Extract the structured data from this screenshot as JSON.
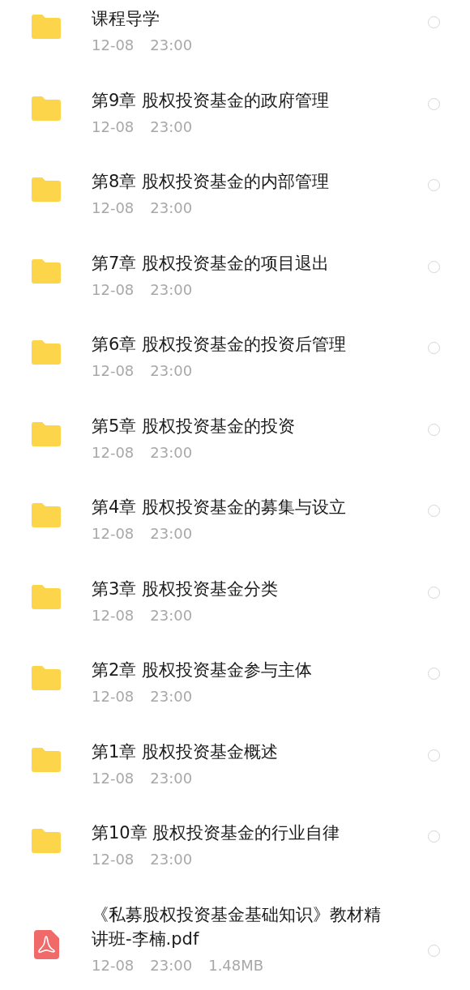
{
  "files": [
    {
      "kind": "folder",
      "name": "课程导学",
      "date": "12-08",
      "time": "23:00",
      "selected": false
    },
    {
      "kind": "folder",
      "name": "第9章 股权投资基金的政府管理",
      "date": "12-08",
      "time": "23:00",
      "selected": false
    },
    {
      "kind": "folder",
      "name": "第8章 股权投资基金的内部管理",
      "date": "12-08",
      "time": "23:00",
      "selected": false
    },
    {
      "kind": "folder",
      "name": "第7章 股权投资基金的项目退出",
      "date": "12-08",
      "time": "23:00",
      "selected": false
    },
    {
      "kind": "folder",
      "name": "第6章 股权投资基金的投资后管理",
      "date": "12-08",
      "time": "23:00",
      "selected": false
    },
    {
      "kind": "folder",
      "name": "第5章 股权投资基金的投资",
      "date": "12-08",
      "time": "23:00",
      "selected": false
    },
    {
      "kind": "folder",
      "name": "第4章 股权投资基金的募集与设立",
      "date": "12-08",
      "time": "23:00",
      "selected": false
    },
    {
      "kind": "folder",
      "name": "第3章 股权投资基金分类",
      "date": "12-08",
      "time": "23:00",
      "selected": false
    },
    {
      "kind": "folder",
      "name": "第2章 股权投资基金参与主体",
      "date": "12-08",
      "time": "23:00",
      "selected": false
    },
    {
      "kind": "folder",
      "name": "第1章 股权投资基金概述",
      "date": "12-08",
      "time": "23:00",
      "selected": false
    },
    {
      "kind": "folder",
      "name": "第10章 股权投资基金的行业自律",
      "date": "12-08",
      "time": "23:00",
      "selected": false
    },
    {
      "kind": "pdf",
      "name": "《私募股权投资基金基础知识》教材精讲班-李楠.pdf",
      "date": "12-08",
      "time": "23:00",
      "size": "1.48MB",
      "selected": false
    }
  ]
}
